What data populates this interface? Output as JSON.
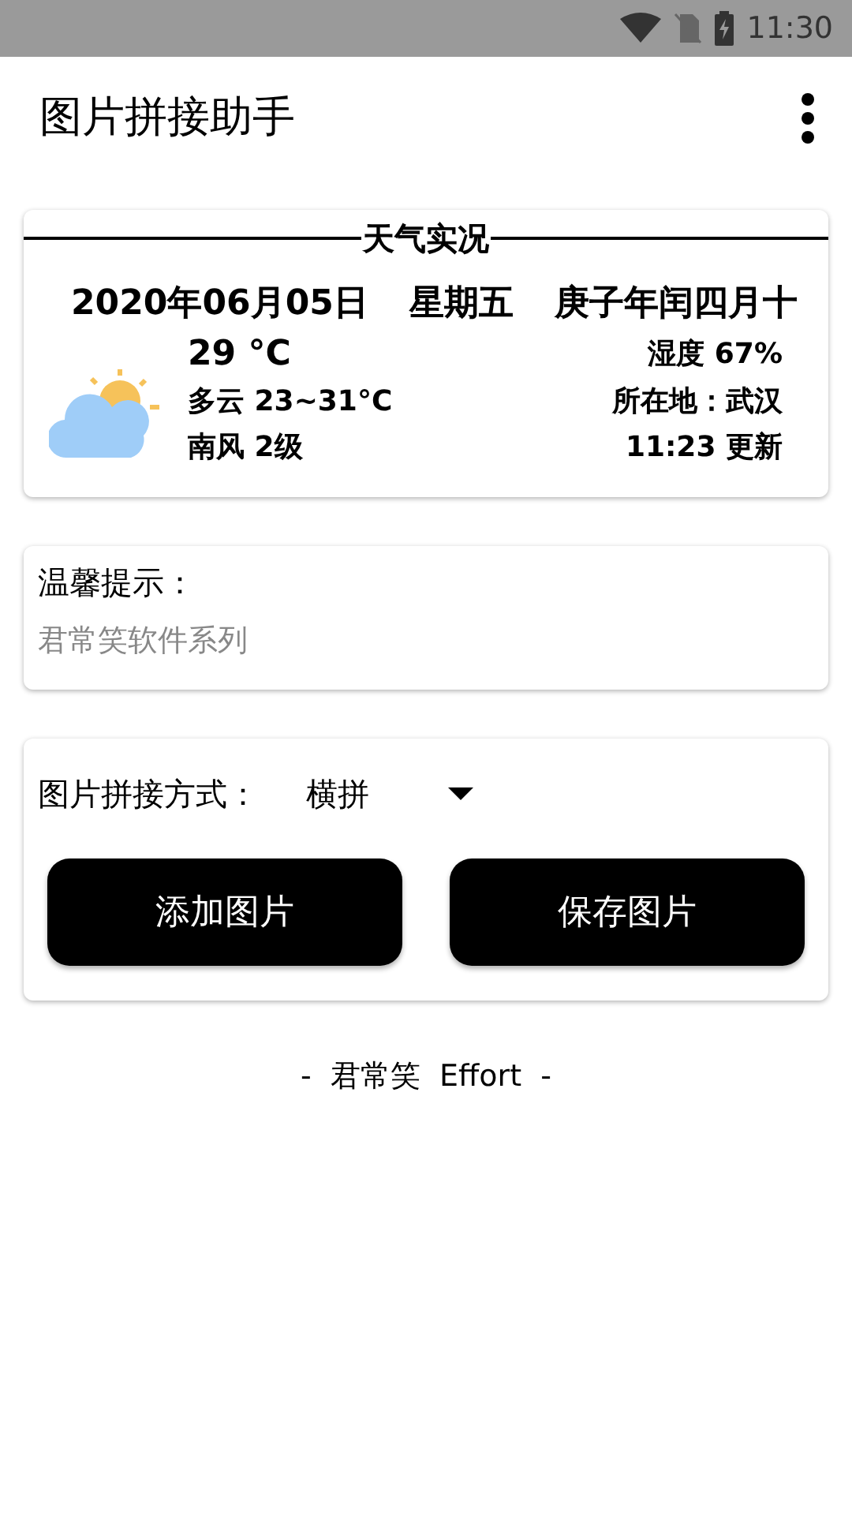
{
  "status_bar": {
    "time": "11:30"
  },
  "app_bar": {
    "title": "图片拼接助手"
  },
  "weather": {
    "title": "天气实况",
    "date": "2020年06月05日",
    "weekday": "星期五",
    "lunar": "庚子年闰四月十",
    "temperature": "29 °C",
    "condition": "多云 23~31°C",
    "wind": "南风 2级",
    "humidity": "湿度 67%",
    "location": "所在地：武汉",
    "updated": "11:23 更新"
  },
  "tip": {
    "title": "温馨提示：",
    "body": "君常笑软件系列"
  },
  "stitch": {
    "label": "图片拼接方式：",
    "mode": "横拼",
    "buttons": [
      "添加图片",
      "保存图片"
    ]
  },
  "footer": "-  君常笑  Effort  -"
}
